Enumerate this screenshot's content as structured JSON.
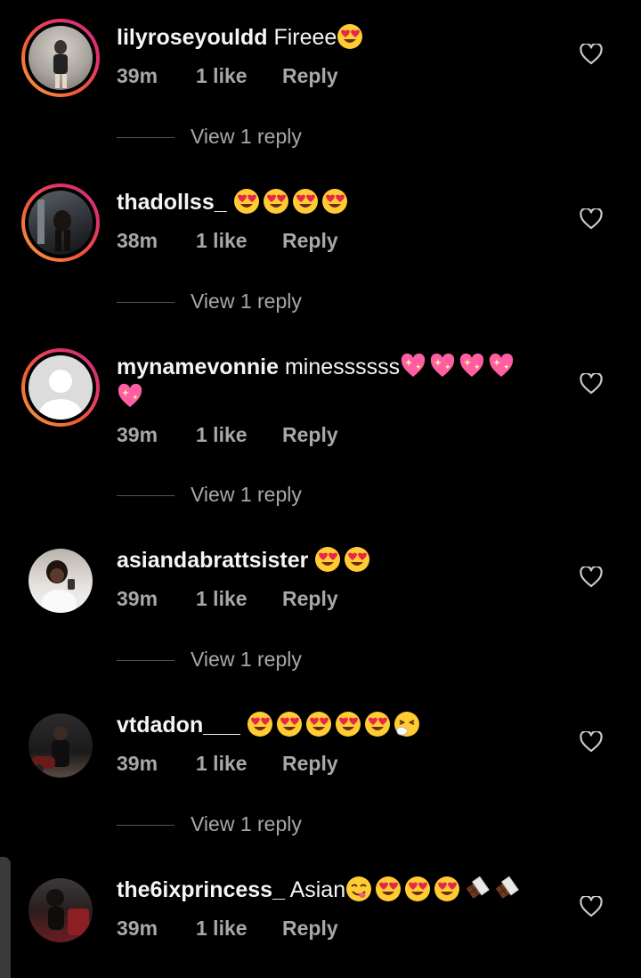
{
  "comments": [
    {
      "username": "lilyroseyouldd",
      "text": "Fireee",
      "emojis": [
        "heart-eyes"
      ],
      "time": "39m",
      "likes": "1 like",
      "reply": "Reply",
      "view_replies": "View 1 reply",
      "ring": true
    },
    {
      "username": "thadollss_",
      "text": "",
      "emojis": [
        "heart-eyes",
        "heart-eyes",
        "heart-eyes",
        "heart-eyes"
      ],
      "time": "38m",
      "likes": "1 like",
      "reply": "Reply",
      "view_replies": "View 1 reply",
      "ring": true
    },
    {
      "username": "mynamevonnie",
      "text": "minessssss",
      "emojis": [
        "sparkling-heart",
        "sparkling-heart",
        "sparkling-heart",
        "sparkling-heart",
        "sparkling-heart"
      ],
      "time": "39m",
      "likes": "1 like",
      "reply": "Reply",
      "view_replies": "View 1 reply",
      "ring": true
    },
    {
      "username": "asiandabrattsister",
      "text": "",
      "emojis": [
        "heart-eyes",
        "heart-eyes"
      ],
      "time": "39m",
      "likes": "1 like",
      "reply": "Reply",
      "view_replies": "View 1 reply",
      "ring": false
    },
    {
      "username": "vtdadon___",
      "text": "",
      "emojis": [
        "heart-eyes",
        "heart-eyes",
        "heart-eyes",
        "heart-eyes",
        "heart-eyes",
        "sneezing-face"
      ],
      "time": "39m",
      "likes": "1 like",
      "reply": "Reply",
      "view_replies": "View 1 reply",
      "ring": false
    },
    {
      "username": "the6ixprincess_",
      "text": "Asian",
      "emojis": [
        "yum-face",
        "heart-eyes",
        "heart-eyes",
        "heart-eyes",
        "chocolate-bar",
        "chocolate-bar"
      ],
      "time": "39m",
      "likes": "1 like",
      "reply": "Reply",
      "view_replies": "",
      "ring": false
    }
  ],
  "colors": {
    "background": "#000000",
    "text": "#f5f5f5",
    "secondary": "#a8a8a8",
    "divider": "#555555"
  }
}
